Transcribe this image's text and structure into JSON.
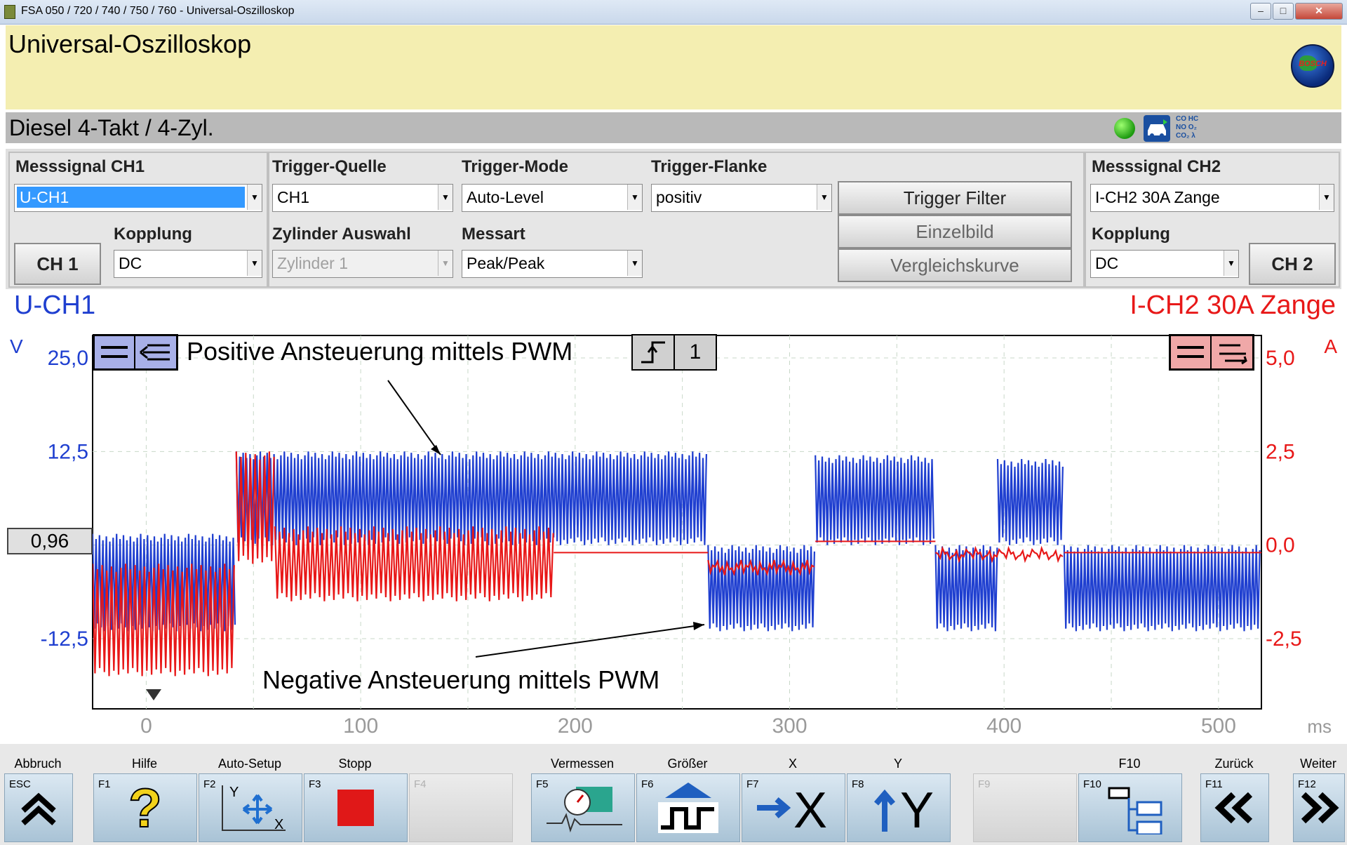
{
  "window": {
    "title": "FSA 050 / 720 / 740 / 750 / 760 - Universal-Oszilloskop",
    "buttons": {
      "minimize": "–",
      "maximize": "□",
      "close": "✕"
    }
  },
  "header": {
    "title": "Universal-Oszilloskop",
    "logo": "BOSCH"
  },
  "status": {
    "vehicle": "Diesel 4-Takt /  4-Zyl.",
    "led_color": "#22bb22",
    "gas_icon_text": "CO HC\nNO O₂\nCO₂ λ"
  },
  "controls": {
    "ch1": {
      "label": "Messsignal CH1",
      "signal": "U-CH1",
      "coupling_label": "Kopplung",
      "coupling": "DC",
      "button": "CH 1"
    },
    "trigger_source": {
      "label": "Trigger-Quelle",
      "value": "CH1"
    },
    "trigger_mode": {
      "label": "Trigger-Mode",
      "value": "Auto-Level"
    },
    "trigger_edge": {
      "label": "Trigger-Flanke",
      "value": "positiv"
    },
    "cylinder": {
      "label": "Zylinder Auswahl",
      "value": "Zylinder 1"
    },
    "measure": {
      "label": "Messart",
      "value": "Peak/Peak"
    },
    "trigger_filter": "Trigger Filter",
    "single_frame": "Einzelbild",
    "compare_curve": "Vergleichskurve",
    "ch2": {
      "label": "Messsignal CH2",
      "signal": "I-CH2 30A Zange",
      "coupling_label": "Kopplung",
      "coupling": "DC",
      "button": "CH 2"
    }
  },
  "scope": {
    "ch1_name": "U-CH1",
    "ch2_name": "I-CH2 30A Zange",
    "ch1_unit": "V",
    "ch2_unit": "A",
    "trigger_level_value": "0,96",
    "trigger_channel": "1",
    "x_unit": "ms",
    "annotation_positive": "Positive Ansteuerung mittels PWM",
    "annotation_negative": "Negative Ansteuerung mittels PWM",
    "colors": {
      "ch1": "#1f3fd0",
      "ch2": "#e81818",
      "grid": "#c8d8c8"
    }
  },
  "chart_data": {
    "type": "line",
    "x_ticks": [
      "0",
      "100",
      "200",
      "300",
      "400",
      "500"
    ],
    "y_left_ticks": [
      "25,0",
      "12,5",
      "-12,5"
    ],
    "y_right_ticks": [
      "5,0",
      "2,5",
      "0,0",
      "-2,5"
    ],
    "xlim": [
      -25,
      520
    ],
    "ylim_left": [
      -25,
      25
    ],
    "ylim_right": [
      -5,
      5
    ],
    "series": [
      {
        "name": "U-CH1",
        "axis": "left",
        "segments": [
          {
            "x0": -25,
            "x1": 42,
            "low": -11.5,
            "high": 1.5
          },
          {
            "x0": 42,
            "x1": 262,
            "low": 0.0,
            "high": 12.5
          },
          {
            "x0": 262,
            "x1": 312,
            "low": -11.5,
            "high": 0.0
          },
          {
            "x0": 312,
            "x1": 368,
            "low": 0.0,
            "high": 12.0
          },
          {
            "x0": 368,
            "x1": 397,
            "low": -11.5,
            "high": 0.0
          },
          {
            "x0": 397,
            "x1": 428,
            "low": 0.0,
            "high": 11.5
          },
          {
            "x0": 428,
            "x1": 520,
            "low": -11.5,
            "high": 0.0
          }
        ]
      },
      {
        "name": "I-CH2 30A Zange",
        "axis": "right",
        "segments": [
          {
            "x0": -25,
            "x1": 42,
            "low": -3.5,
            "high": -0.5
          },
          {
            "x0": 42,
            "x1": 60,
            "low": -0.5,
            "high": 2.5
          },
          {
            "x0": 60,
            "x1": 190,
            "low": -1.5,
            "high": 0.5
          },
          {
            "x0": 190,
            "x1": 262,
            "low": -0.2,
            "high": -0.2
          },
          {
            "x0": 262,
            "x1": 312,
            "low": -0.8,
            "high": -0.4
          },
          {
            "x0": 312,
            "x1": 368,
            "low": 0.1,
            "high": 0.1
          },
          {
            "x0": 368,
            "x1": 428,
            "low": -0.3,
            "high": -0.2
          },
          {
            "x0": 428,
            "x1": 520,
            "low": -0.2,
            "high": -0.2
          }
        ]
      }
    ]
  },
  "fkeys": [
    {
      "caption": "Abbruch",
      "num": "ESC",
      "icon": "double-up-chevron-icon",
      "enabled": true
    },
    {
      "caption": "Hilfe",
      "num": "F1",
      "icon": "question-mark-icon",
      "enabled": true
    },
    {
      "caption": "Auto-Setup",
      "num": "F2",
      "icon": "auto-setup-icon",
      "enabled": true
    },
    {
      "caption": "Stopp",
      "num": "F3",
      "icon": "stop-icon",
      "enabled": true
    },
    {
      "caption": "",
      "num": "F4",
      "icon": "",
      "enabled": false
    },
    {
      "caption": "Vermessen",
      "num": "F5",
      "icon": "measure-icon",
      "enabled": true
    },
    {
      "caption": "Größer",
      "num": "F6",
      "icon": "enlarge-icon",
      "enabled": true
    },
    {
      "caption": "X",
      "num": "F7",
      "icon": "x-axis-icon",
      "enabled": true
    },
    {
      "caption": "Y",
      "num": "F8",
      "icon": "y-axis-icon",
      "enabled": true
    },
    {
      "caption": "",
      "num": "F9",
      "icon": "",
      "enabled": false
    },
    {
      "caption": "F10",
      "num": "F10",
      "icon": "layout-icon",
      "enabled": true
    },
    {
      "caption": "Zurück",
      "num": "F11",
      "icon": "back-icon",
      "enabled": true
    },
    {
      "caption": "Weiter",
      "num": "F12",
      "icon": "forward-icon",
      "enabled": true
    }
  ],
  "fkey_glyphs": {
    "help": "?",
    "x": "X",
    "y": "Y",
    "setup_x": "X",
    "setup_y": "Y"
  }
}
